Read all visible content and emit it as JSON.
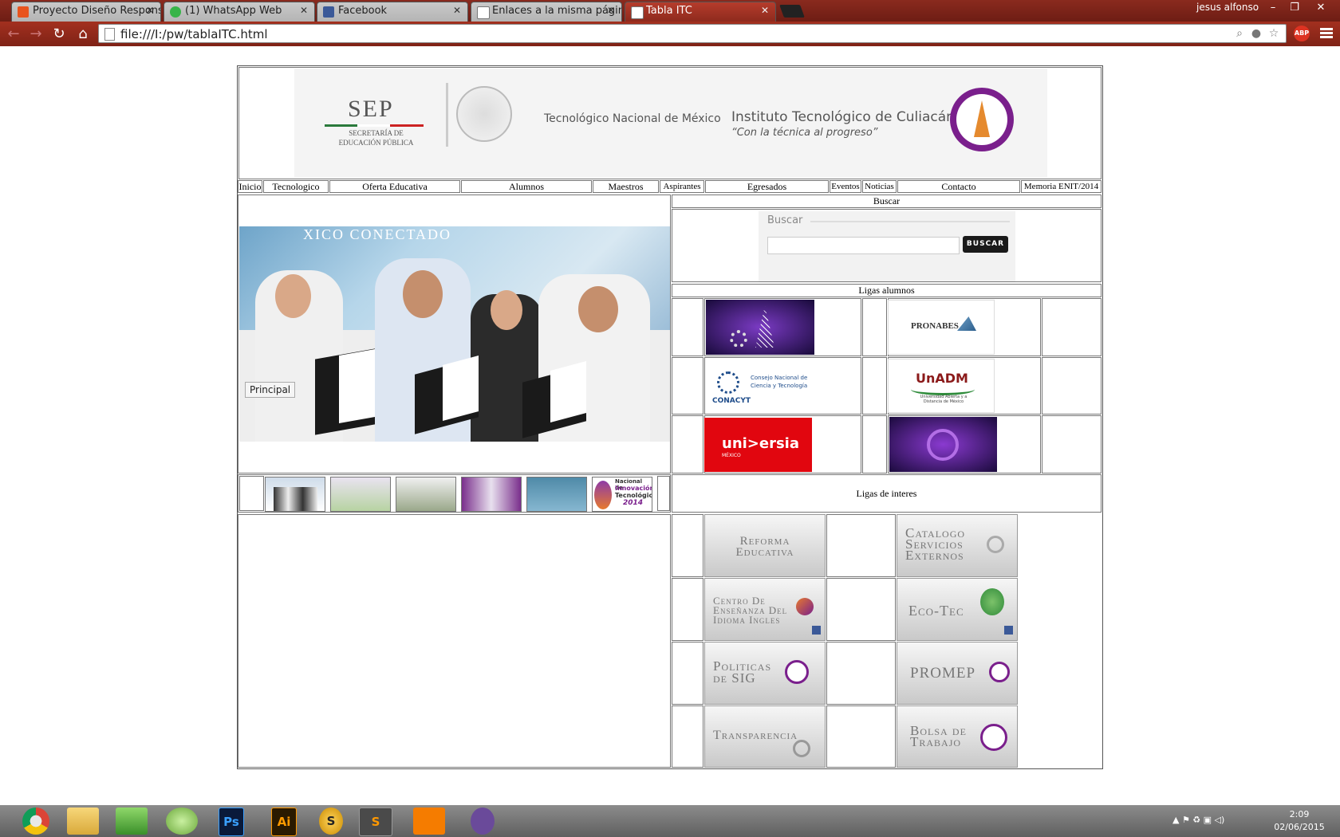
{
  "browser": {
    "tabs": [
      {
        "title": "Proyecto Diseño Responsi",
        "favicon_color": "#e8541e"
      },
      {
        "title": "(1) WhatsApp Web",
        "favicon_color": "#38b449"
      },
      {
        "title": "Facebook",
        "favicon_color": "#3b5998"
      },
      {
        "title": "Enlaces a la misma página",
        "favicon_color": "#ffffff"
      },
      {
        "title": "Tabla ITC",
        "favicon_color": "#ffffff"
      }
    ],
    "user": "jesus alfonso",
    "url": "file:///I:/pw/tablaITC.html",
    "abp_label": "ABP"
  },
  "header": {
    "sep_title": "SEP",
    "sep_sub1": "SECRETARÍA DE",
    "sep_sub2": "EDUCACIÓN PÚBLICA",
    "tecnm": "Tecnológico Nacional de México",
    "itc_name": "Instituto Tecnológico de Culiacán",
    "itc_motto": "“Con la técnica al progreso”"
  },
  "nav": [
    "Inicio",
    "Tecnologico",
    "Oferta Educativa",
    "Alumnos",
    "Maestros",
    "Aspirantes",
    "Egresados",
    "Eventos",
    "Noticias",
    "Contacto",
    "Memoria ENIT/2014"
  ],
  "slider": {
    "caption": "Principal",
    "bg_text": "XICO CONECTADO"
  },
  "search": {
    "heading": "Buscar",
    "widget_label": "Buscar",
    "button": "BUSCAR",
    "value": ""
  },
  "ligas_alumnos": {
    "heading": "Ligas alumnos",
    "logos": [
      "PRONABES",
      "CONACYT",
      "Consejo Nacional de",
      "Ciencia y Tecnología",
      "UnADM",
      "Universidad Abierta y a Distancia de México",
      "uni>ersia",
      "MÉXICO"
    ]
  },
  "thumbs_text": {
    "t6a": "Nacional de",
    "t6b": "Innovación",
    "t6c": "Tecnológica",
    "t6d": "2014"
  },
  "ligas_interes": {
    "heading": "Ligas de interes",
    "buttons": [
      {
        "line1": "Reforma",
        "line2": "Educativa",
        "line3": ""
      },
      {
        "line1": "Catalogo",
        "line2": "Servicios",
        "line3": "Externos"
      },
      {
        "line1": "Centro De",
        "line2": "Enseñanza Del",
        "line3": "Idioma Ingles"
      },
      {
        "line1": "Eco-Tec",
        "line2": "",
        "line3": ""
      },
      {
        "line1": "Politicas",
        "line2": "de SIG",
        "line3": ""
      },
      {
        "line1": "PROMEP",
        "line2": "",
        "line3": ""
      },
      {
        "line1": "Transparencia",
        "line2": "",
        "line3": ""
      },
      {
        "line1": "Bolsa de",
        "line2": "Trabajo",
        "line3": ""
      }
    ]
  },
  "taskbar": {
    "time": "2:09",
    "date": "02/06/2015",
    "apps": [
      "Chrome",
      "Explorer",
      "Dreamweaver",
      "Edge",
      "Ps",
      "Ai",
      "Sublime S",
      "S",
      "XAMPP",
      "GitHub"
    ]
  },
  "colors": {
    "chrome_red": "#8e2a1d",
    "itc_purple": "#7a1f8c",
    "universia_red": "#e1060f",
    "buscar_btn": "#1a1a1a"
  }
}
